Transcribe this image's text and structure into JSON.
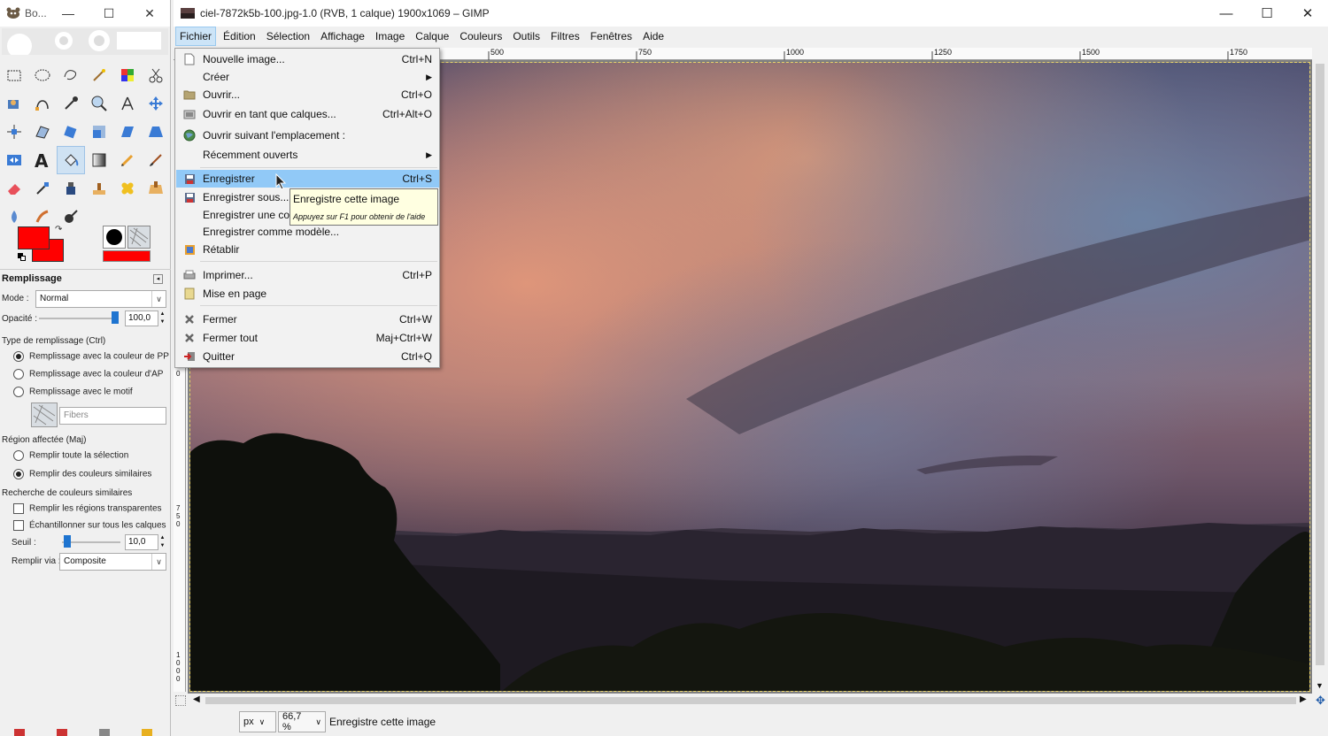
{
  "toolbox": {
    "title": "Bo...",
    "tool_options": {
      "header": "Remplissage",
      "mode_label": "Mode :",
      "mode_value": "Normal",
      "opacity_label": "Opacité :",
      "opacity_value": "100,0",
      "opacity_fraction": 1.0,
      "fill_type_label": "Type de remplissage  (Ctrl)",
      "fill_type_options": [
        "Remplissage avec la couleur de PP",
        "Remplissage avec la couleur d'AP",
        "Remplissage avec le motif"
      ],
      "fill_type_selected": 0,
      "pattern_name": "Fibers",
      "region_label": "Région affectée  (Maj)",
      "region_options": [
        "Remplir toute la sélection",
        "Remplir des couleurs similaires"
      ],
      "region_selected": 1,
      "similar_label": "Recherche de couleurs similaires",
      "check_transparent": "Remplir les régions transparentes",
      "check_sample_merged": "Échantillonner sur tous les calques",
      "threshold_label": "Seuil :",
      "threshold_value": "10,0",
      "threshold_fraction": 0.04,
      "fill_by_label": "Remplir via :",
      "fill_by_value": "Composite"
    },
    "fg_color": "#ff0000",
    "bg_color": "#ff0000"
  },
  "image_window": {
    "title": "ciel-7872k5b-100.jpg-1.0 (RVB, 1 calque) 1900x1069 – GIMP",
    "menus": [
      {
        "label": "Fichier",
        "u": "F",
        "rest": "ichier"
      },
      {
        "label": "Édition",
        "u": "É",
        "rest": "dition"
      },
      {
        "label": "Sélection",
        "u": "S",
        "rest": "élection"
      },
      {
        "label": "Affichage",
        "u": "A",
        "rest": "ffichage"
      },
      {
        "label": "Image",
        "u": "I",
        "rest": "mage"
      },
      {
        "label": "Calque",
        "u": "C",
        "rest": "alque"
      },
      {
        "label": "Couleurs",
        "u": "C",
        "rest": "ouleurs"
      },
      {
        "label": "Outils",
        "u": "O",
        "rest": "utils"
      },
      {
        "label": "Filtres",
        "u": "F",
        "rest": "iltres"
      },
      {
        "label": "Fenêtres",
        "u": "n",
        "rest": "Fe|êtres"
      },
      {
        "label": "Aide",
        "u": "A",
        "rest": "ide"
      }
    ],
    "ruler_top_labels": [
      "500",
      "750",
      "1000",
      "1250",
      "1500",
      "1750"
    ],
    "ruler_left_labels": [
      "0",
      "750",
      "1000"
    ],
    "status": {
      "unit": "px",
      "zoom": "66,7 %",
      "message": "Enregistre cette image"
    }
  },
  "file_menu": {
    "items": [
      {
        "label": "Nouvelle image...",
        "accel": "Ctrl+N",
        "icon": "new-image-icon"
      },
      {
        "label": "Créer",
        "accel": "",
        "submenu": true,
        "icon": ""
      },
      {
        "label": "Ouvrir...",
        "accel": "Ctrl+O",
        "icon": "folder-icon"
      },
      {
        "label": "Ouvrir en tant que calques...",
        "accel": "Ctrl+Alt+O",
        "icon": "open-layers-icon"
      },
      {
        "label": "Ouvrir suivant l'emplacement :",
        "accel": "",
        "icon": "globe-icon"
      },
      {
        "label": "Récemment ouverts",
        "accel": "",
        "submenu": true,
        "icon": ""
      },
      {
        "label": "Enregistrer",
        "accel": "Ctrl+S",
        "icon": "save-icon",
        "highlighted": true
      },
      {
        "label": "Enregistrer sous...",
        "accel": "",
        "icon": "save-as-icon"
      },
      {
        "label": "Enregistrer une cop",
        "accel": "",
        "icon": ""
      },
      {
        "label": "Enregistrer comme modèle...",
        "accel": "",
        "icon": ""
      },
      {
        "label": "Rétablir",
        "accel": "",
        "icon": "revert-icon"
      },
      {
        "label": "Imprimer...",
        "accel": "Ctrl+P",
        "icon": "print-icon"
      },
      {
        "label": "Mise en page",
        "accel": "",
        "icon": "page-setup-icon"
      },
      {
        "label": "Fermer",
        "accel": "Ctrl+W",
        "icon": "close-x-icon"
      },
      {
        "label": "Fermer tout",
        "accel": "Maj+Ctrl+W",
        "icon": "close-all-icon"
      },
      {
        "label": "Quitter",
        "accel": "Ctrl+Q",
        "icon": "quit-icon"
      }
    ]
  },
  "tooltip": {
    "title": "Enregistre cette image",
    "hint": "Appuyez sur F1 pour obtenir de l'aide"
  },
  "colors": {
    "menu_highlight": "#91c9f7",
    "tooltip_bg": "#ffffe1"
  }
}
